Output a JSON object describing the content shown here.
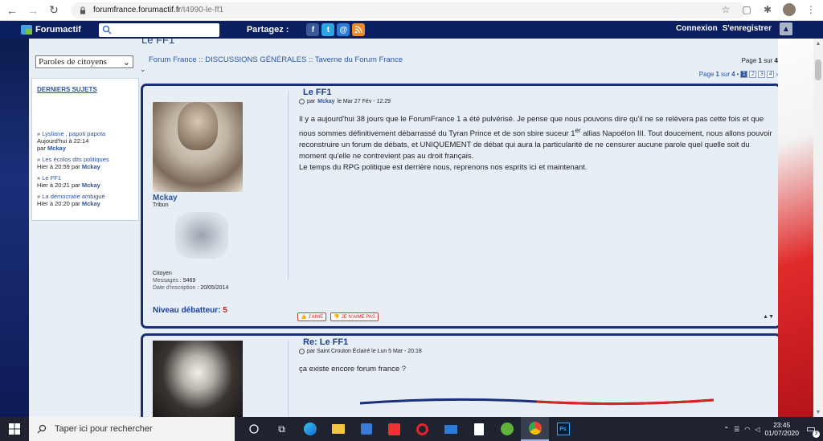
{
  "browser": {
    "url_domain": "forumfrance.forumactif.fr",
    "url_path": "/t4990-le-ff1"
  },
  "toolbar": {
    "brand": "Forumactif",
    "share_label": "Partagez :",
    "share_icons": [
      "f",
      "t",
      "@",
      "rss"
    ],
    "login": "Connexion",
    "register": "S'enregistrer"
  },
  "page": {
    "title_partial": "Le FF1"
  },
  "sidebar": {
    "select_value": "Paroles de citoyens",
    "box_title": "DERNIERS SUJETS",
    "items": [
      {
        "title": "Lysliane , papoti papota",
        "time": "Aujourd'hui à 22:14",
        "by": "par",
        "user": "Mckay"
      },
      {
        "title": "Les écolos dits politiques",
        "time": "Hier à 20:59",
        "by": "par",
        "user": "Mckay"
      },
      {
        "title": "Le FF1",
        "time": "Hier à 20:21",
        "by": "par",
        "user": "Mckay"
      },
      {
        "title": "La démocratie ambiguë",
        "time": "Hier à 20:20",
        "by": "par",
        "user": "Mckay"
      }
    ]
  },
  "breadcrumb": {
    "a": "Forum France",
    "b": "DISCUSSIONS GÉNÉRALES",
    "c": "Taverne du Forum France",
    "sep": "::"
  },
  "pagination": {
    "page_of_label": "Page",
    "current": "1",
    "of_label": "sur",
    "total": "4",
    "pages": [
      "1",
      "2",
      "3",
      "4"
    ],
    "next": "›"
  },
  "post1": {
    "title": "Le FF1",
    "meta_by": "par",
    "meta_user": "Mckay",
    "meta_date": "le Mar 27 Fév - 12:29",
    "username": "Mckay",
    "rank": "Tribun",
    "group": "Citoyen",
    "messages_label": "Messages",
    "messages": "5469",
    "signup_label": "Date d'inscription",
    "signup": "20/05/2014",
    "level_label": "Niveau débatteur:",
    "level": "5",
    "body_p1": "Il y a aujourd'hui 38 jours que le ForumFrance 1 a été pulvérisé. Je pense que nous pouvons dire qu'il ne se relèvera pas cette fois et que nous sommes définitivement débarrassé du Tyran Prince et de son sbire suceur 1",
    "body_sup": "er",
    "body_p1b": " allias Napoélon III. Tout doucement, nous allons pouvoir reconstruire un forum de débats, et UNIQUEMENT de débat qui aura la particularité de ne censurer aucune parole quel quelle soit du moment qu'elle ne contrevient pas au droit français.",
    "body_p2": "Le temps du RPG politique est derrière nous, reprenons nos esprits ici et maintenant.",
    "like": "J'AIME",
    "dislike": "JE N'AIME PAS"
  },
  "post2": {
    "title": "Re: Le FF1",
    "meta": "par Saint Crouton Éclairé le Lun 5 Mar - 20:18",
    "body": "ça existe encore forum france ?"
  },
  "taskbar": {
    "search_placeholder": "Taper ici pour rechercher",
    "time": "23:45",
    "date": "01/07/2020",
    "notif_count": "3"
  }
}
